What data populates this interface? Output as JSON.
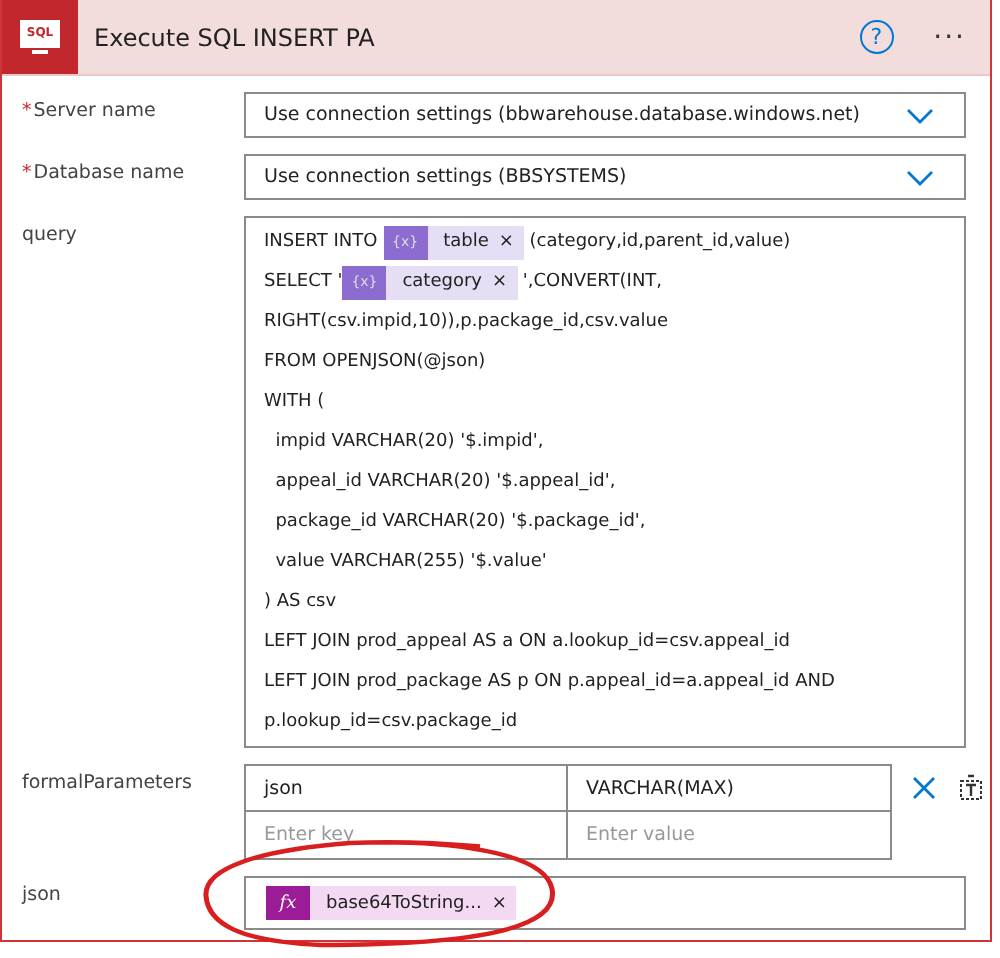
{
  "header": {
    "icon_text": "SQL",
    "title": "Execute SQL INSERT PA",
    "help": "?",
    "more": "···"
  },
  "fields": [
    {
      "label": "Server name",
      "required": true,
      "required_mark": "*",
      "value": "Use connection settings (bbwarehouse.database.windows.net)",
      "kind": "dropdown"
    },
    {
      "label": "Database name",
      "required": true,
      "required_mark": "*",
      "value": "Use connection settings (BBSYSTEMS)",
      "kind": "dropdown"
    }
  ],
  "query": {
    "label": "query",
    "lines": [
      [
        {
          "kind": "text",
          "text": "INSERT INTO "
        },
        {
          "kind": "variable",
          "icon": "{x}",
          "text": "table",
          "remove": "×"
        },
        {
          "kind": "text",
          "text": " (category,id,parent_id,value)"
        }
      ],
      [
        {
          "kind": "text",
          "text": "SELECT '"
        },
        {
          "kind": "variable",
          "icon": "{x}",
          "text": "category",
          "remove": "×"
        },
        {
          "kind": "text",
          "text": " ',CONVERT(INT,"
        }
      ],
      [
        {
          "kind": "text",
          "text": "RIGHT(csv.impid,10)),p.package_id,csv.value"
        }
      ],
      [
        {
          "kind": "text",
          "text": "FROM OPENJSON(@json)"
        }
      ],
      [
        {
          "kind": "text",
          "text": "WITH ("
        }
      ],
      [
        {
          "kind": "text",
          "text": "  impid VARCHAR(20) '$.impid',"
        }
      ],
      [
        {
          "kind": "text",
          "text": "  appeal_id VARCHAR(20) '$.appeal_id',"
        }
      ],
      [
        {
          "kind": "text",
          "text": "  package_id VARCHAR(20) '$.package_id',"
        }
      ],
      [
        {
          "kind": "text",
          "text": "  value VARCHAR(255) '$.value'"
        }
      ],
      [
        {
          "kind": "text",
          "text": ") AS csv"
        }
      ],
      [
        {
          "kind": "text",
          "text": "LEFT JOIN prod_appeal AS a ON a.lookup_id=csv.appeal_id"
        }
      ],
      [
        {
          "kind": "text",
          "text": "LEFT JOIN prod_package AS p ON p.appeal_id=a.appeal_id AND"
        }
      ],
      [
        {
          "kind": "text",
          "text": "p.lookup_id=csv.package_id"
        }
      ]
    ]
  },
  "formal_parameters": {
    "label": "formalParameters",
    "rows": [
      {
        "key": "json",
        "value": "VARCHAR(MAX)"
      }
    ],
    "new_row": {
      "key_placeholder": "Enter key",
      "value_placeholder": "Enter value"
    }
  },
  "json": {
    "label": "json",
    "tokens": [
      {
        "kind": "function",
        "icon": "fx",
        "text": "base64ToString...",
        "remove": "×"
      }
    ]
  }
}
